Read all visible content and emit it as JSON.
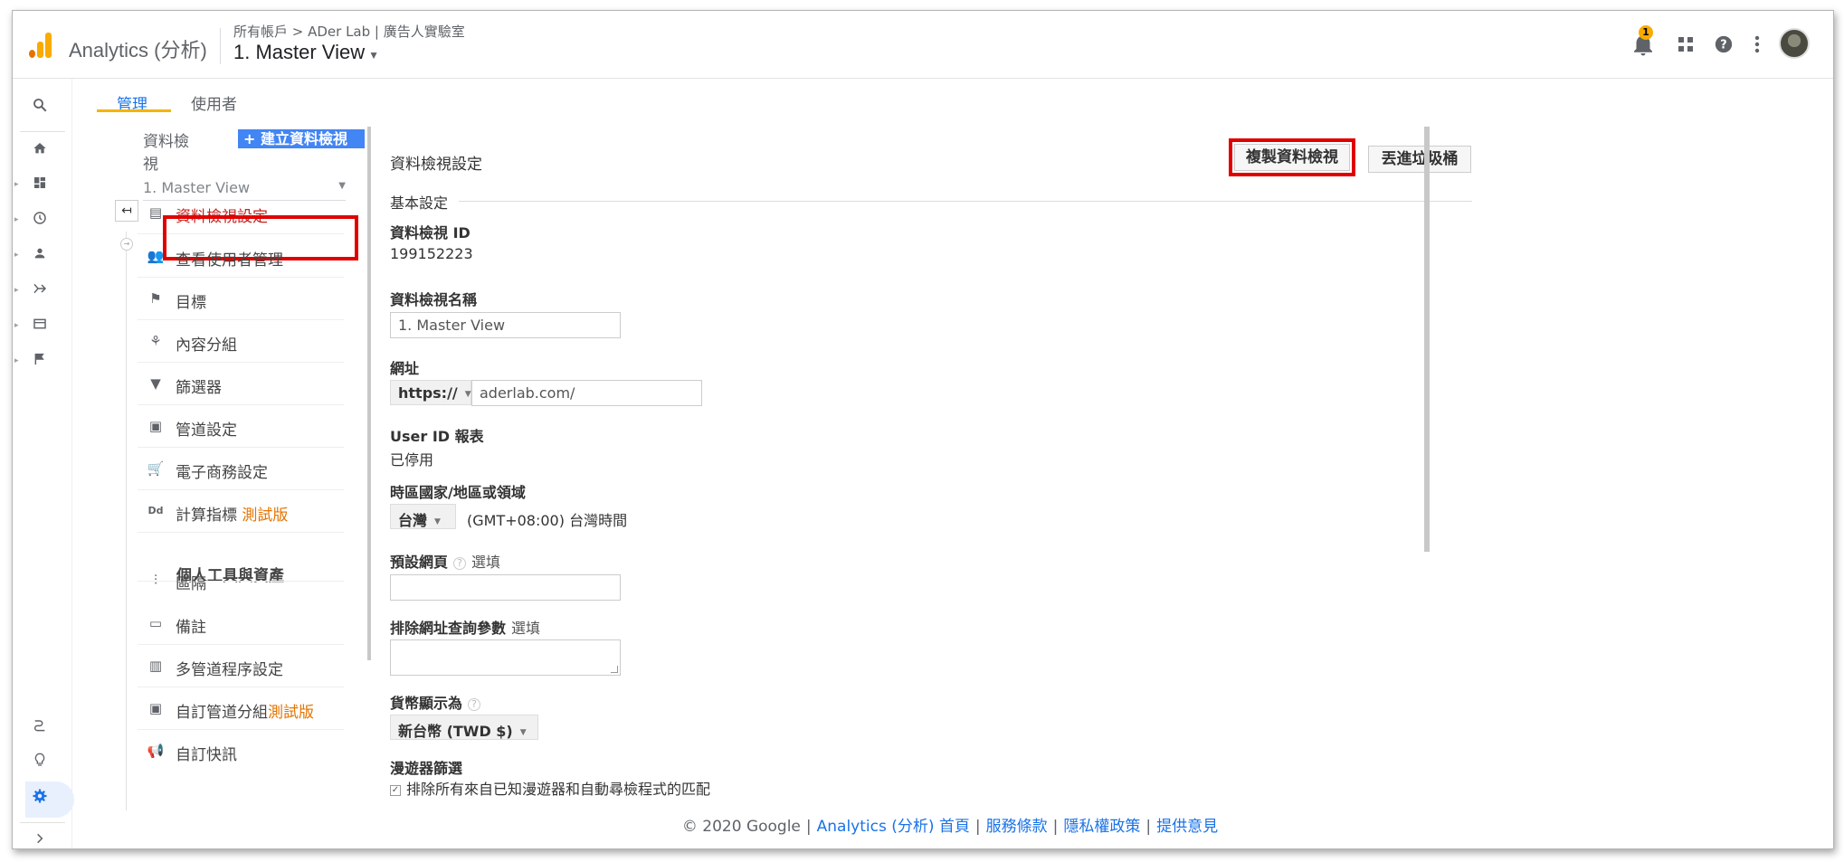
{
  "app": {
    "title": "Analytics (分析)"
  },
  "header": {
    "breadcrumb": "所有帳戶 > ADer Lab | 廣告人實驗室",
    "view": "1. Master View",
    "notification_count": "1",
    "icons": [
      "bell-icon",
      "apps-grid-icon",
      "help-icon",
      "more-vert-icon",
      "avatar"
    ]
  },
  "rail": {
    "icons": [
      "search-icon",
      "home-icon",
      "dashboard-icon",
      "clock-icon",
      "person-icon",
      "acquisition-icon",
      "behavior-icon",
      "flag-icon",
      "attribution-icon",
      "lightbulb-icon",
      "gear-icon",
      "expand-icon"
    ]
  },
  "tabs": [
    {
      "label": "管理",
      "active": true
    },
    {
      "label": "使用者",
      "active": false
    }
  ],
  "view_column": {
    "label": "資料檢視",
    "create_button": "+ 建立資料檢視",
    "selected_view": "1. Master View",
    "menu": [
      {
        "icon": "document-icon",
        "label": "資料檢視設定",
        "active": true
      },
      {
        "icon": "people-icon",
        "label": "查看使用者管理"
      },
      {
        "icon": "flag-icon",
        "label": "目標"
      },
      {
        "icon": "content-grouping-icon",
        "label": "內容分組"
      },
      {
        "icon": "filter-icon",
        "label": "篩選器"
      },
      {
        "icon": "channel-icon",
        "label": "管道設定"
      },
      {
        "icon": "cart-icon",
        "label": "電子商務設定"
      },
      {
        "icon": "calculated-metric-icon",
        "label": "計算指標",
        "beta": "測試版"
      }
    ],
    "personal_section": "個人工具與資產",
    "personal_menu": [
      {
        "icon": "segments-icon",
        "label": "區隔"
      },
      {
        "icon": "annotation-icon",
        "label": "備註"
      },
      {
        "icon": "bar-chart-icon",
        "label": "多管道程序設定"
      },
      {
        "icon": "channel-grouping-icon",
        "label": "自訂管道分組",
        "beta": "測試版"
      },
      {
        "icon": "megaphone-icon",
        "label": "自訂快訊"
      }
    ]
  },
  "settings": {
    "title": "資料檢視設定",
    "copy_button": "複製資料檢視",
    "trash_button": "丟進垃圾桶",
    "basic_section": "基本設定",
    "view_id_label": "資料檢視 ID",
    "view_id": "199152223",
    "view_name_label": "資料檢視名稱",
    "view_name": "1. Master View",
    "url_label": "網址",
    "protocol": "https://",
    "url": "aderlab.com/",
    "userid_label": "User ID 報表",
    "userid_value": "已停用",
    "timezone_label": "時區國家/地區或領域",
    "timezone_country": "台灣",
    "timezone_value": "(GMT+08:00) 台灣時間",
    "default_page_label": "預設網頁",
    "optional": "選填",
    "default_page": "",
    "exclude_params_label": "排除網址查詢參數",
    "exclude_params": "",
    "currency_label": "貨幣顯示為",
    "currency": "新台幣 (TWD $)",
    "bot_label": "漫遊器篩選",
    "bot_check": "排除所有來自已知漫遊器和自動尋檢程式的匹配"
  },
  "footer": {
    "copyright": "© 2020 Google",
    "links": [
      "Analytics (分析) 首頁",
      "服務條款",
      "隱私權政策",
      "提供意見"
    ]
  },
  "colors": {
    "accent": "#1a73e8",
    "highlight": "#e00000",
    "tab_underline": "#f4b400",
    "beta": "#e37400"
  }
}
